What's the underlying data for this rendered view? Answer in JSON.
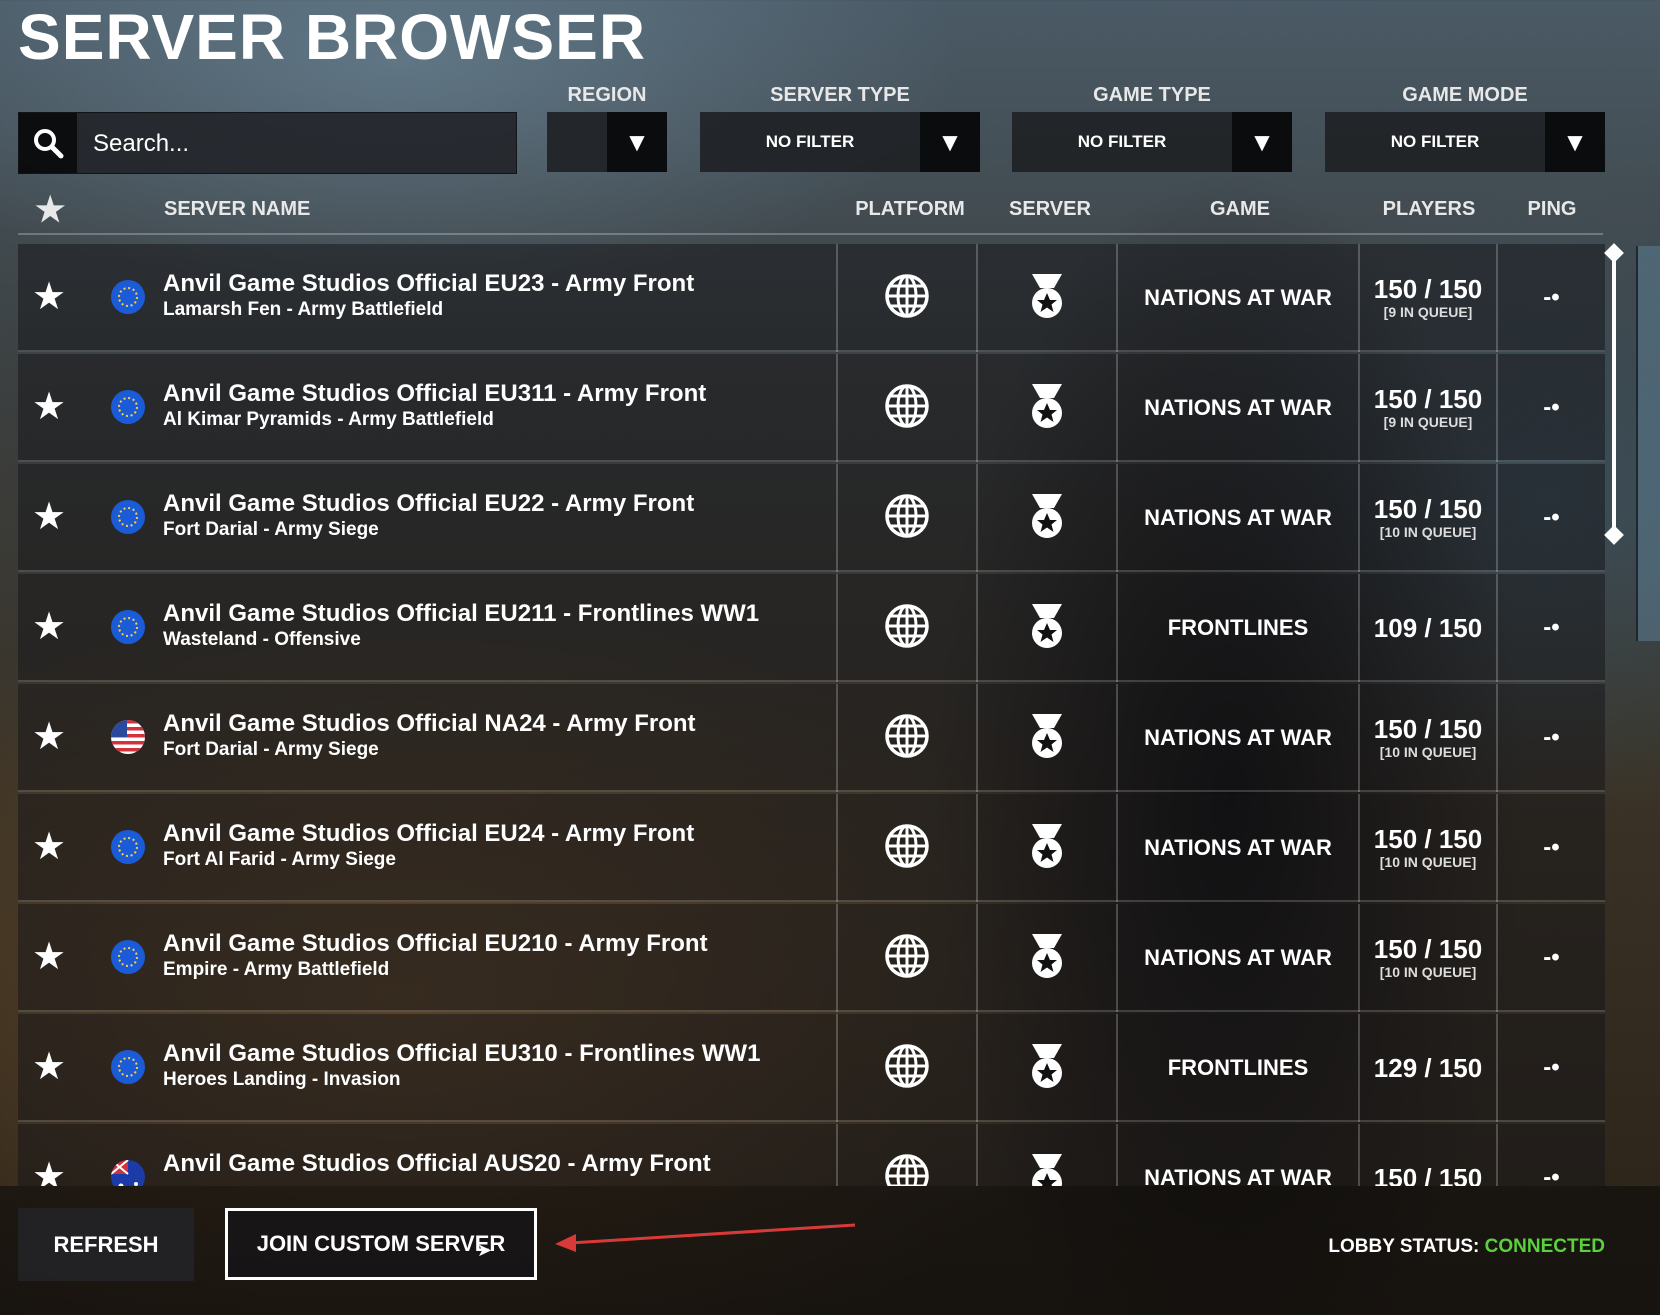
{
  "page": {
    "title": "SERVER BROWSER"
  },
  "search": {
    "placeholder": "Search..."
  },
  "filters": {
    "region": {
      "label": "REGION",
      "value": ""
    },
    "server_type": {
      "label": "SERVER TYPE",
      "value": "NO FILTER"
    },
    "game_type": {
      "label": "GAME TYPE",
      "value": "NO FILTER"
    },
    "game_mode": {
      "label": "GAME MODE",
      "value": "NO FILTER"
    }
  },
  "columns": {
    "favorite": "★",
    "server_name": "SERVER NAME",
    "platform": "PLATFORM",
    "server": "SERVER",
    "game": "GAME",
    "players": "PLAYERS",
    "ping": "PING"
  },
  "servers": [
    {
      "name": "Anvil Game Studios Official EU23 - Army Front",
      "map": "Lamarsh Fen - Army Battlefield",
      "region": "eu",
      "game": "NATIONS AT WAR",
      "players": "150 / 150",
      "queue": "[9 IN QUEUE]",
      "ping": "-•"
    },
    {
      "name": "Anvil Game Studios Official EU311 - Army Front",
      "map": "Al Kimar Pyramids - Army Battlefield",
      "region": "eu",
      "game": "NATIONS AT WAR",
      "players": "150 / 150",
      "queue": "[9 IN QUEUE]",
      "ping": "-•"
    },
    {
      "name": "Anvil Game Studios Official EU22 - Army Front",
      "map": "Fort Darial - Army Siege",
      "region": "eu",
      "game": "NATIONS AT WAR",
      "players": "150 / 150",
      "queue": "[10 IN QUEUE]",
      "ping": "-•"
    },
    {
      "name": "Anvil Game Studios Official EU211 - Frontlines WW1",
      "map": "Wasteland - Offensive",
      "region": "eu",
      "game": "FRONTLINES",
      "players": "109 / 150",
      "queue": "",
      "ping": "-•"
    },
    {
      "name": "Anvil Game Studios Official NA24 - Army Front",
      "map": "Fort Darial - Army Siege",
      "region": "us",
      "game": "NATIONS AT WAR",
      "players": "150 / 150",
      "queue": "[10 IN QUEUE]",
      "ping": "-•"
    },
    {
      "name": "Anvil Game Studios Official EU24 - Army Front",
      "map": "Fort Al Farid - Army Siege",
      "region": "eu",
      "game": "NATIONS AT WAR",
      "players": "150 / 150",
      "queue": "[10 IN QUEUE]",
      "ping": "-•"
    },
    {
      "name": "Anvil Game Studios Official EU210 - Army Front",
      "map": "Empire - Army Battlefield",
      "region": "eu",
      "game": "NATIONS AT WAR",
      "players": "150 / 150",
      "queue": "[10 IN QUEUE]",
      "ping": "-•"
    },
    {
      "name": "Anvil Game Studios Official EU310 - Frontlines WW1",
      "map": "Heroes Landing - Invasion",
      "region": "eu",
      "game": "FRONTLINES",
      "players": "129 / 150",
      "queue": "",
      "ping": "-•"
    },
    {
      "name": "Anvil Game Studios Official AUS20 - Army Front",
      "map": "",
      "region": "au",
      "game": "NATIONS AT WAR",
      "players": "150 / 150",
      "queue": "",
      "ping": "-•"
    }
  ],
  "buttons": {
    "refresh": "REFRESH",
    "join_custom": "JOIN CUSTOM SERVER"
  },
  "lobby_status": {
    "label": "LOBBY STATUS:",
    "value": "CONNECTED",
    "color": "#5ad23c"
  },
  "icons": {
    "platform": "globe-icon",
    "server": "official-medal-icon",
    "favorite": "star-icon",
    "search": "search-icon"
  }
}
